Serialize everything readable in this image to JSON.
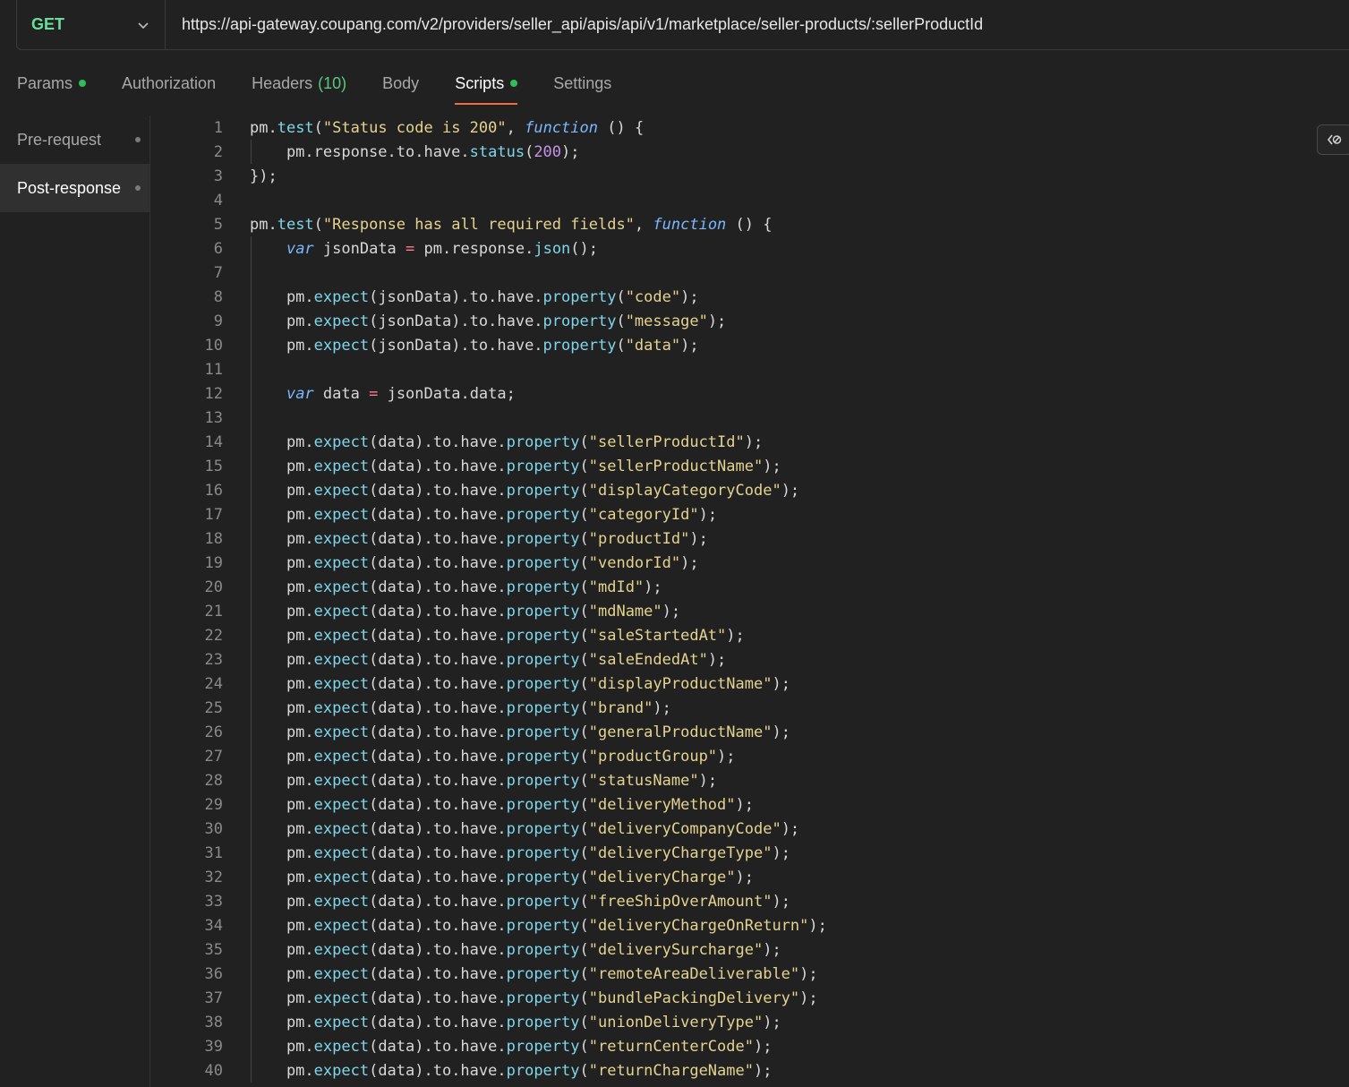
{
  "request": {
    "method": "GET",
    "url": "https://api-gateway.coupang.com/v2/providers/seller_api/apis/api/v1/marketplace/seller-products/:sellerProductId"
  },
  "tabs": [
    {
      "label": "Params",
      "dot": true
    },
    {
      "label": "Authorization"
    },
    {
      "label": "Headers",
      "count": "(10)"
    },
    {
      "label": "Body"
    },
    {
      "label": "Scripts",
      "dot": true,
      "active": true
    },
    {
      "label": "Settings"
    }
  ],
  "sidebar": {
    "items": [
      {
        "label": "Pre-request"
      },
      {
        "label": "Post-response",
        "active": true
      }
    ]
  },
  "editor": {
    "lines": [
      "pm.test(\"Status code is 200\", function () {",
      "    pm.response.to.have.status(200);",
      "});",
      "",
      "pm.test(\"Response has all required fields\", function () {",
      "    var jsonData = pm.response.json();",
      "",
      "    pm.expect(jsonData).to.have.property(\"code\");",
      "    pm.expect(jsonData).to.have.property(\"message\");",
      "    pm.expect(jsonData).to.have.property(\"data\");",
      "",
      "    var data = jsonData.data;",
      "",
      "    pm.expect(data).to.have.property(\"sellerProductId\");",
      "    pm.expect(data).to.have.property(\"sellerProductName\");",
      "    pm.expect(data).to.have.property(\"displayCategoryCode\");",
      "    pm.expect(data).to.have.property(\"categoryId\");",
      "    pm.expect(data).to.have.property(\"productId\");",
      "    pm.expect(data).to.have.property(\"vendorId\");",
      "    pm.expect(data).to.have.property(\"mdId\");",
      "    pm.expect(data).to.have.property(\"mdName\");",
      "    pm.expect(data).to.have.property(\"saleStartedAt\");",
      "    pm.expect(data).to.have.property(\"saleEndedAt\");",
      "    pm.expect(data).to.have.property(\"displayProductName\");",
      "    pm.expect(data).to.have.property(\"brand\");",
      "    pm.expect(data).to.have.property(\"generalProductName\");",
      "    pm.expect(data).to.have.property(\"productGroup\");",
      "    pm.expect(data).to.have.property(\"statusName\");",
      "    pm.expect(data).to.have.property(\"deliveryMethod\");",
      "    pm.expect(data).to.have.property(\"deliveryCompanyCode\");",
      "    pm.expect(data).to.have.property(\"deliveryChargeType\");",
      "    pm.expect(data).to.have.property(\"deliveryCharge\");",
      "    pm.expect(data).to.have.property(\"freeShipOverAmount\");",
      "    pm.expect(data).to.have.property(\"deliveryChargeOnReturn\");",
      "    pm.expect(data).to.have.property(\"deliverySurcharge\");",
      "    pm.expect(data).to.have.property(\"remoteAreaDeliverable\");",
      "    pm.expect(data).to.have.property(\"bundlePackingDelivery\");",
      "    pm.expect(data).to.have.property(\"unionDeliveryType\");",
      "    pm.expect(data).to.have.property(\"returnCenterCode\");",
      "    pm.expect(data).to.have.property(\"returnChargeName\");"
    ]
  },
  "colors": {
    "method": "#6bdd9a",
    "active_tab_underline": "#f26b3a",
    "status_dot": "#2fbf5a",
    "string": "#e4d38f",
    "function_call": "#7fd6ea",
    "keyword": "#7ab8ff",
    "number": "#c792ea"
  },
  "icons": {
    "method_dropdown": "chevron-down-icon",
    "editor_action": "snippet-icon"
  }
}
